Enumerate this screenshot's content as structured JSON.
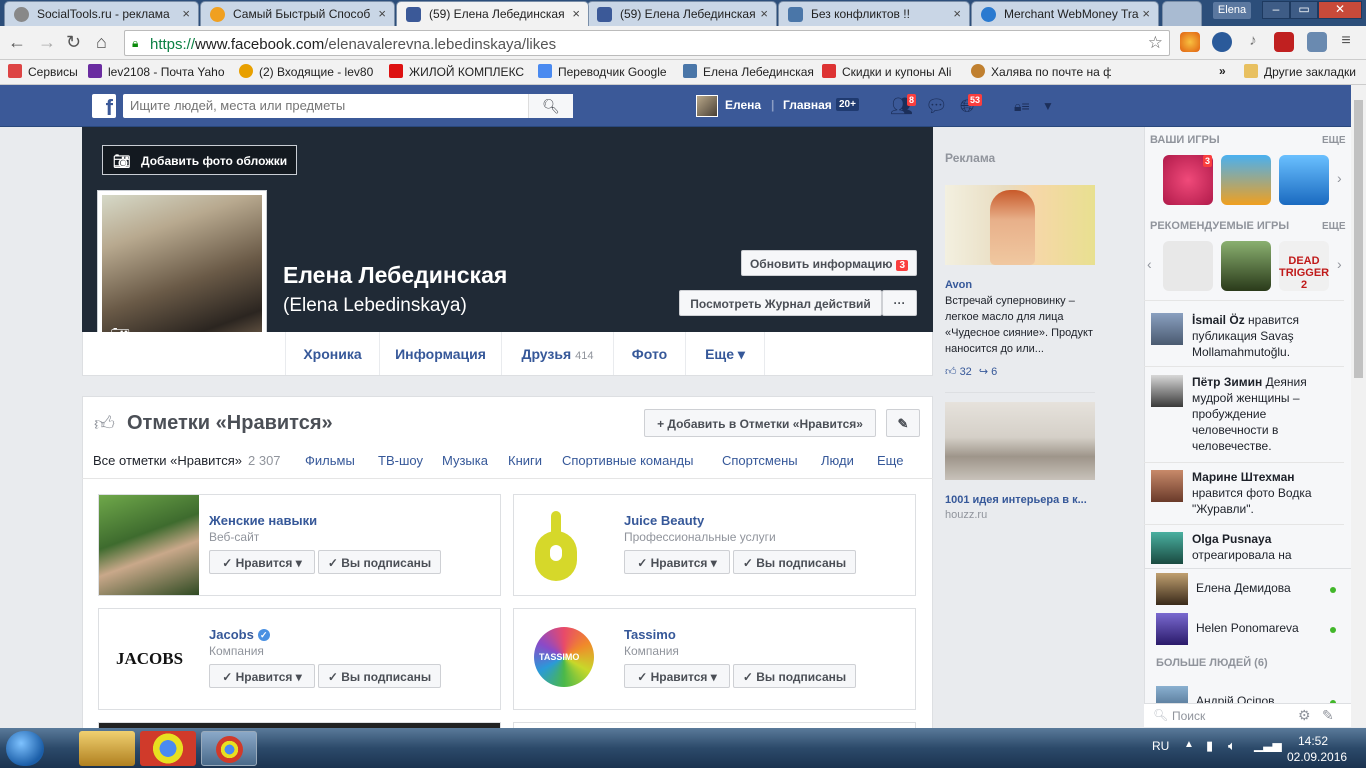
{
  "browser": {
    "tabs": [
      {
        "label": "SocialTools.ru - реклама",
        "color": "#888888"
      },
      {
        "label": "Самый Быстрый Способ",
        "color": "#f0a020"
      },
      {
        "label": "(59) Елена Лебединская",
        "color": "#3b5998"
      },
      {
        "label": "(59) Елена Лебединская",
        "color": "#3b5998"
      },
      {
        "label": "Без конфликтов !!",
        "color": "#4a76a8"
      },
      {
        "label": "Merchant WebMoney Tra",
        "color": "#2a7ad0"
      }
    ],
    "user_chip": "Elena",
    "url_scheme": "https://",
    "url_host": "www.facebook.com",
    "url_path": "/elenavalerevna.lebedinskaya/likes",
    "bookmarks": [
      {
        "label": "Сервисы",
        "color": "#d44"
      },
      {
        "label": "lev2108 - Почта Yaho",
        "color": "#6a2ca0"
      },
      {
        "label": "(2) Входящие - lev80",
        "color": "#e8a000"
      },
      {
        "label": "ЖИЛОЙ КОМПЛЕКС",
        "color": "#d11"
      },
      {
        "label": "Переводчик Google",
        "color": "#4a8af0"
      },
      {
        "label": "Елена Лебединская",
        "color": "#4a76a8"
      },
      {
        "label": "Скидки и купоны Ali",
        "color": "#d33"
      },
      {
        "label": "Халява по почте на ф",
        "color": "#c08030"
      }
    ],
    "bookmarks_more": "»",
    "other_bookmarks": "Другие закладки"
  },
  "fb": {
    "search_placeholder": "Ищите людей, места или предметы",
    "user_name": "Елена",
    "home_label": "Главная",
    "home_count": "20+",
    "friend_requests": "8",
    "notifications": "53"
  },
  "profile": {
    "add_cover": "Добавить фото обложки",
    "name": "Елена Лебединская",
    "alt_name": "(Elena Lebedinskaya)",
    "update_info": "Обновить информацию",
    "update_count": "3",
    "activity_log": "Посмотреть Журнал действий",
    "more_dots": "···",
    "nav": [
      {
        "label": "Хроника",
        "count": ""
      },
      {
        "label": "Информация",
        "count": ""
      },
      {
        "label": "Друзья",
        "count": "414"
      },
      {
        "label": "Фото",
        "count": ""
      },
      {
        "label": "Еще ▾",
        "count": ""
      }
    ]
  },
  "likes": {
    "title": "Отметки «Нравится»",
    "add_button": "+ Добавить в Отметки «Нравится»",
    "edit_icon": "✎",
    "tabs": [
      {
        "label": "Все отметки «Нравится»",
        "count": "2 307"
      },
      {
        "label": "Фильмы",
        "count": ""
      },
      {
        "label": "ТВ-шоу",
        "count": ""
      },
      {
        "label": "Музыка",
        "count": ""
      },
      {
        "label": "Книги",
        "count": ""
      },
      {
        "label": "Спортивные команды",
        "count": ""
      },
      {
        "label": "Спортсмены",
        "count": ""
      },
      {
        "label": "Люди",
        "count": ""
      },
      {
        "label": "Еще",
        "count": ""
      }
    ],
    "like_btn": "✓ Нравится ▾",
    "follow_btn": "✓ Вы подписаны",
    "cards": [
      {
        "title": "Женские навыки",
        "category": "Веб-сайт"
      },
      {
        "title": "Juice Beauty",
        "category": "Профессиональные услуги"
      },
      {
        "title": "Jacobs",
        "category": "Компания"
      },
      {
        "title": "Tassimo",
        "category": "Компания"
      }
    ],
    "jacobs_logo": "JACOBS",
    "tassimo_logo": "TASSIMO"
  },
  "ads": {
    "label": "Реклама",
    "ad1_sponsor": "Avon",
    "ad1_text": "Встречай суперновинку – легкое масло для лица «Чудесное сияние». Продукт наносится до или...",
    "ad1_likes": "32",
    "ad1_shares": "6",
    "ad2_title": "1001 идея интерьера в к...",
    "ad2_domain": "houzz.ru"
  },
  "sidebar": {
    "your_games": "ВАШИ ИГРЫ",
    "recommended_games": "РЕКОМЕНДУЕМЫЕ ИГРЫ",
    "more": "ЕЩЕ",
    "game_badge": "3",
    "ticker": [
      {
        "name": "İsmail Öz",
        "text": "нравится публикация Savaş Mollamahmutoğlu."
      },
      {
        "name": "Пётр Зимин",
        "text": "Деяния мудрой женщины – пробуждение человечности в человечестве."
      },
      {
        "name": "Марине Штехман",
        "text": "нравится фото Водка \"Журавли\"."
      },
      {
        "name": "Olga Pusnaya",
        "text": "отреагировала на"
      }
    ],
    "chat": [
      {
        "name": "Елена Демидова"
      },
      {
        "name": "Helen Ponomareva"
      }
    ],
    "more_people": "БОЛЬШЕ ЛЮДЕЙ (6)",
    "partial_person": "Андрій Осіпов",
    "chat_search": "Поиск"
  },
  "taskbar": {
    "lang": "RU",
    "time": "14:52",
    "date": "02.09.2016"
  }
}
